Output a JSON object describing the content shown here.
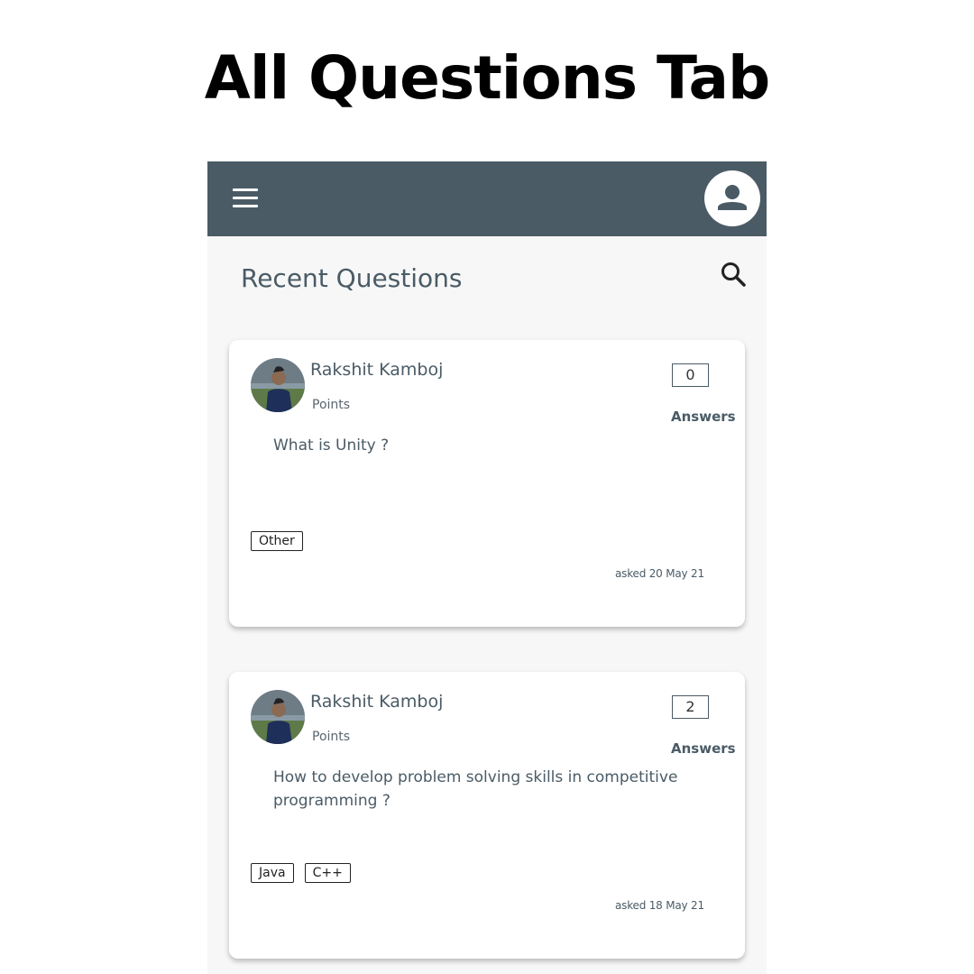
{
  "page_title": "All Questions Tab",
  "app": {
    "menu_icon": "hamburger-menu-icon",
    "profile_icon": "account-circle-icon",
    "search_icon": "search-icon",
    "section_title": "Recent Questions"
  },
  "questions": [
    {
      "author": "Rakshit Kamboj",
      "points_label": "Points",
      "answer_count": "0",
      "answers_label": "Answers",
      "text": "What is Unity ?",
      "tags": [
        "Other"
      ],
      "asked": "asked 20 May 21"
    },
    {
      "author": "Rakshit Kamboj",
      "points_label": "Points",
      "answer_count": "2",
      "answers_label": "Answers",
      "text": "How to develop problem solving skills in competitive programming ?",
      "tags": [
        "Java",
        "C++"
      ],
      "asked": "asked 18 May 21"
    }
  ],
  "colors": {
    "appbar": "#4a5b66",
    "background": "#f7f7f7",
    "accent_text": "#4a5b66"
  }
}
